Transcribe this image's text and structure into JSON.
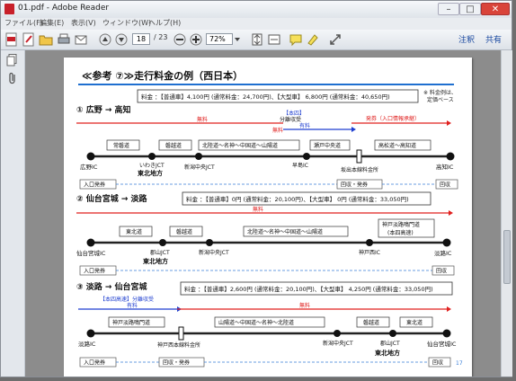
{
  "window": {
    "title": "01.pdf - Adobe Reader"
  },
  "menu": [
    "ファイル(F)",
    "編集(E)",
    "表示(V)",
    "ウィンドウ(W)",
    "ヘルプ(H)"
  ],
  "toolbar": {
    "page_current": "18",
    "page_total": "/ 23",
    "zoom": "72%",
    "comment": "注釈",
    "share": "共有"
  },
  "page": {
    "title": "≪参考 ⑦≫走行料金の例（西日本）",
    "note": [
      "※ 料金例は、",
      "定価ベース"
    ],
    "page_number": "17",
    "routes": [
      {
        "heading": "① 広野 → 高知",
        "fee": "料金 ：【普通車】4,100円 (通常料金：24,700円)、【大型車】 6,800円 (通常料金：40,650円)",
        "free_label": "無料",
        "free_label2": "無料",
        "honshi": [
          "【本四】",
          "分離収受"
        ],
        "paid_label": "有料",
        "toll_label": "発券（入口情報承継）",
        "segments": [
          "常磐道",
          "磐越道",
          "北陸道～名神～中国道～山陽道",
          "瀬戸中央道",
          "高松道～高知道"
        ],
        "stations": [
          "広野IC",
          "いわきJCT",
          "東北地方",
          "新潟中央JCT",
          "早島IC",
          "坂出本線料金所",
          "高知IC"
        ],
        "actions": [
          "入口発券",
          "回収・発券",
          "回収"
        ]
      },
      {
        "heading": "② 仙台宮城 → 淡路",
        "fee": "料金 ：【普通車】0円 (通常料金：20,100円)、【大型車】 0円 (通常料金：33,050円)",
        "free_label": "無料",
        "segments": [
          "東北道",
          "磐越道",
          "北陸道～名神～中国道～山陽道",
          "神戸淡路鳴門道",
          "(本四高速)"
        ],
        "stations": [
          "仙台宮城IC",
          "郡山JCT",
          "東北地方",
          "新潟中央JCT",
          "神戸西IC",
          "淡路IC"
        ],
        "actions": [
          "入口発券",
          "回収"
        ]
      },
      {
        "heading": "③ 淡路 → 仙台宮城",
        "fee": "料金 ：【普通車】2,600円 (通常料金：20,100円)、【大型車】 4,250円 (通常料金：33,050円)",
        "honshi": "【本四高速】分離収受",
        "paid_label": "有料",
        "free_label": "無料",
        "segments": [
          "神戸淡路鳴門道",
          "山陽道～中国道～名神～北陸道",
          "磐越道",
          "東北道"
        ],
        "stations": [
          "淡路IC",
          "神戸西本線料金所",
          "新潟中央JCT",
          "郡山JCT",
          "仙台宮城IC",
          "東北地方"
        ],
        "actions": [
          "入口発券",
          "回収・発券",
          "回収"
        ]
      }
    ]
  }
}
